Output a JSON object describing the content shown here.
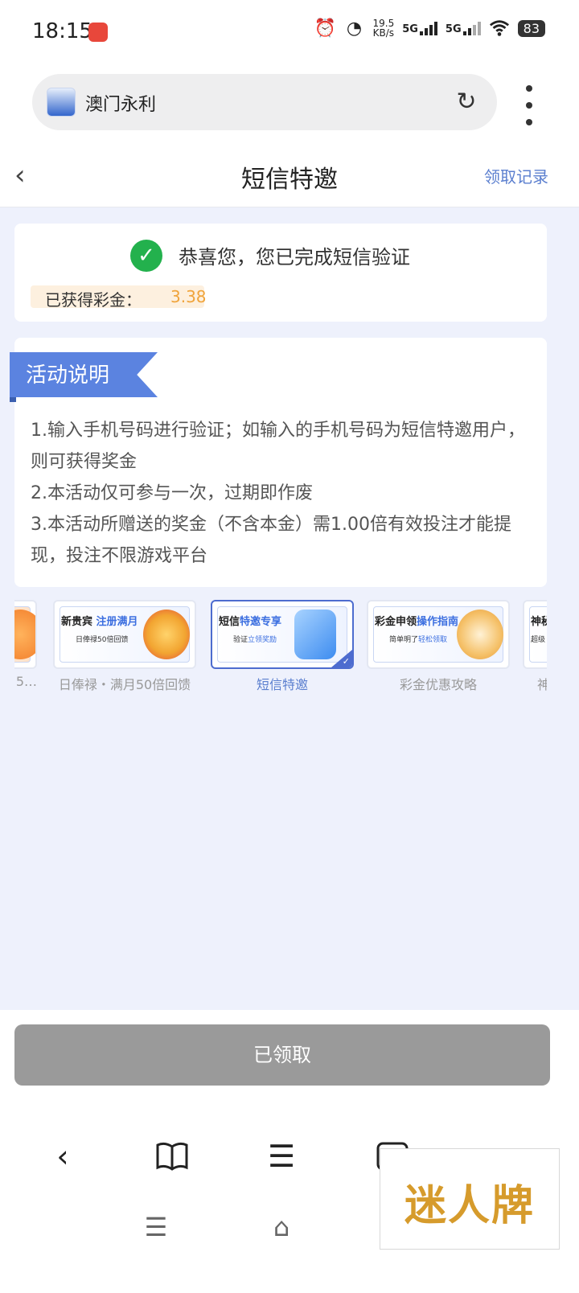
{
  "status_bar": {
    "time": "18:15",
    "speed_value": "19.5",
    "speed_unit": "KB/s",
    "network_1": "5G",
    "network_2": "5G",
    "battery": "83"
  },
  "browser": {
    "url_text": "澳门永利"
  },
  "header": {
    "title": "短信特邀",
    "record_link": "领取记录"
  },
  "verify": {
    "message": "恭喜您，您已完成短信验证",
    "bonus_label": "已获得彩金：",
    "bonus_value": "3.38"
  },
  "activity": {
    "title": "活动说明",
    "rules": [
      "1.输入手机号码进行验证；如输入的手机号码为短信特邀用户，则可获得奖金",
      "2.本活动仅可参与一次，过期即作废",
      "3.本活动所赠送的奖金（不含本金）需1.00倍有效投注才能提现，投注不限游戏平台"
    ]
  },
  "banners": [
    {
      "label": "5…",
      "heading": "",
      "heading_hl": "",
      "sub": "",
      "sub_hl": ""
    },
    {
      "label": "日俸禄・满月50倍回馈",
      "heading": "新贵宾",
      "heading_hl": "注册满月",
      "sub": "日俸禄50倍回馈",
      "sub_hl": ""
    },
    {
      "label": "短信特邀",
      "heading": "短信",
      "heading_hl": "特邀专享",
      "sub": "验证",
      "sub_hl": "立领奖励"
    },
    {
      "label": "彩金优惠攻略",
      "heading": "彩金申领",
      "heading_hl": "操作指南",
      "sub": "简单明了",
      "sub_hl": "轻松领取"
    },
    {
      "label": "神",
      "heading": "神秘",
      "heading_hl": "",
      "sub": "超级",
      "sub_hl": ""
    }
  ],
  "footer": {
    "button_label": "已领取"
  },
  "watermark": {
    "text": "迷人牌"
  },
  "icons": {
    "alarm": "alarm-clock-icon",
    "speedometer": "speedometer-icon",
    "wifi": "wifi-icon",
    "reload": "reload-icon",
    "more": "more-vertical-icon",
    "back": "chevron-left-icon",
    "check": "check-circle-icon"
  },
  "colors": {
    "accent": "#5b83e0",
    "link": "#5b7fcf",
    "bonus": "#f0a43b",
    "success": "#23b14d",
    "disabled_button": "#9a9a9a",
    "page_bg": "#eef1fc"
  }
}
